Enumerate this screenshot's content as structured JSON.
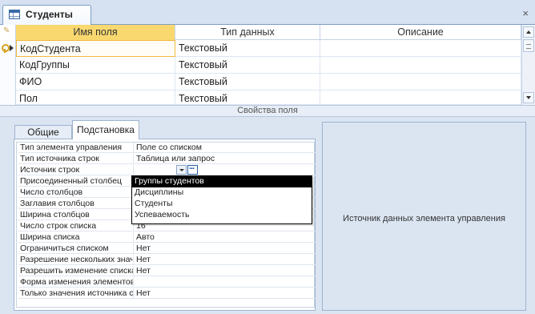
{
  "tab": {
    "title": "Студенты",
    "close_glyph": "×"
  },
  "grid": {
    "columns": [
      "Имя поля",
      "Тип данных",
      "Описание"
    ],
    "rows": [
      {
        "name": "КодСтудента",
        "type": "Текстовый",
        "description": ""
      },
      {
        "name": "КодГруппы",
        "type": "Текстовый",
        "description": ""
      },
      {
        "name": "ФИО",
        "type": "Текстовый",
        "description": ""
      },
      {
        "name": "Пол",
        "type": "Текстовый",
        "description": ""
      }
    ]
  },
  "section_title": "Свойства поля",
  "property_tabs": [
    "Общие",
    "Подстановка"
  ],
  "properties": [
    {
      "label": "Тип элемента управления",
      "value": "Поле со списком"
    },
    {
      "label": "Тип источника строк",
      "value": "Таблица или запрос"
    },
    {
      "label": "Источник строк",
      "value": ""
    },
    {
      "label": "Присоединенный столбец",
      "value": ""
    },
    {
      "label": "Число столбцов",
      "value": ""
    },
    {
      "label": "Заглавия столбцов",
      "value": ""
    },
    {
      "label": "Ширина столбцов",
      "value": ""
    },
    {
      "label": "Число строк списка",
      "value": "16"
    },
    {
      "label": "Ширина списка",
      "value": "Авто"
    },
    {
      "label": "Ограничиться списком",
      "value": "Нет"
    },
    {
      "label": "Разрешение нескольких значений",
      "value": "Нет"
    },
    {
      "label": "Разрешить изменение списка значений",
      "value": "Нет"
    },
    {
      "label": "Форма изменения элементов списка",
      "value": ""
    },
    {
      "label": "Только значения источника строк",
      "value": "Нет"
    }
  ],
  "dropdown_options": [
    "Группы студентов",
    "Дисциплины",
    "Студенты",
    "Успеваемость"
  ],
  "help_text": "Источник данных элемента управления"
}
